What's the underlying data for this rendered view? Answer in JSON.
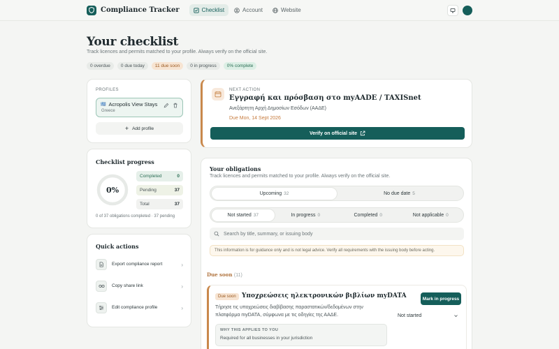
{
  "app": {
    "name": "Compliance Tracker",
    "nav": [
      {
        "label": "Checklist",
        "icon": "checklist-icon",
        "active": true
      },
      {
        "label": "Account",
        "icon": "user-circle-icon",
        "active": false
      },
      {
        "label": "Website",
        "icon": "globe-icon",
        "active": false
      }
    ],
    "accent": "#155e5a"
  },
  "header": {
    "title": "Your checklist",
    "subtitle": "Track licences and permits matched to your profile. Always verify on the official site.",
    "chips": [
      "0 overdue",
      "0 due today",
      "11 due soon",
      "0 in progress",
      "0% complete"
    ]
  },
  "profiles": {
    "label": "PROFILES",
    "items": [
      {
        "name": "Acropolis View Stays",
        "country": "Greece",
        "flag": "🇬🇷"
      }
    ],
    "add_label": "Add profile"
  },
  "progress": {
    "title": "Checklist progress",
    "percent_label": "0%",
    "percent": 0,
    "stats": [
      {
        "label": "Completed",
        "value": "0"
      },
      {
        "label": "Pending",
        "value": "37"
      },
      {
        "label": "Total",
        "value": "37"
      }
    ],
    "note": "0 of 37 obligations completed · 37 pending"
  },
  "quick_actions": {
    "title": "Quick actions",
    "items": [
      {
        "label": "Export compliance report",
        "icon": "document-icon"
      },
      {
        "label": "Copy share link",
        "icon": "link-icon"
      },
      {
        "label": "Edit compliance profile",
        "icon": "sliders-icon"
      }
    ]
  },
  "next_action": {
    "label": "NEXT ACTION",
    "title": "Εγγραφή και πρόσβαση στο myAADE / TAXISnet",
    "authority": "Ανεξάρτητη Αρχή Δημοσίων Εσόδων (ΑΑΔΕ)",
    "due": "Due Mon, 14 Sept 2026",
    "verify_label": "Verify on official site"
  },
  "obligations": {
    "title": "Your obligations",
    "subtitle": "Track licences and permits matched to your profile. Always verify on the official site.",
    "timing_tabs": [
      {
        "label": "Upcoming",
        "count": "32",
        "active": true
      },
      {
        "label": "No due date",
        "count": "5",
        "active": false
      }
    ],
    "status_tabs": [
      {
        "label": "Not started",
        "count": "37",
        "active": true
      },
      {
        "label": "In progress",
        "count": "0",
        "active": false
      },
      {
        "label": "Completed",
        "count": "0",
        "active": false
      },
      {
        "label": "Not applicable",
        "count": "0",
        "active": false
      }
    ],
    "search_placeholder": "Search by title, summary, or issuing body",
    "notice": "This information is for guidance only and is not legal advice. Verify all requirements with the issuing body before acting.",
    "group_label": "Due soon",
    "group_count": "(11)",
    "item": {
      "badge": "Due soon",
      "title": "Υποχρεώσεις ηλεκτρονικών βιβλίων myDATA",
      "description": "Τήρησε τις υποχρεώσεις διαβίβασης παραστατικών/δεδομένων στην πλατφόρμα myDATA, σύμφωνα με τις οδηγίες της ΑΑΔΕ.",
      "mark_label": "Mark in progress",
      "status": "Not started",
      "why_label": "WHY THIS APPLIES TO YOU",
      "why_text": "Required for all businesses in your jurisdiction"
    }
  }
}
